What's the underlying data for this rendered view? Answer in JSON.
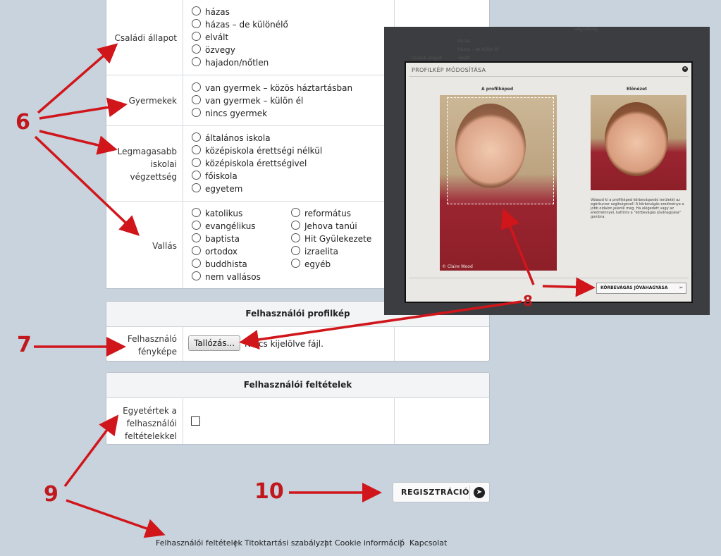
{
  "form": {
    "marital": {
      "label": "Családi állapot",
      "options": [
        "házas",
        "házas – de különélő",
        "elvált",
        "özvegy",
        "hajadon/nőtlen"
      ]
    },
    "children": {
      "label": "Gyermekek",
      "options": [
        "van gyermek – közös háztartásban",
        "van gyermek – külön él",
        "nincs gyermek"
      ]
    },
    "education": {
      "label_lines": [
        "Legmagasabb",
        "iskolai",
        "végzettség"
      ],
      "options": [
        "általános iskola",
        "középiskola érettségi nélkül",
        "középiskola érettségivel",
        "főiskola",
        "egyetem"
      ]
    },
    "religion": {
      "label": "Vallás",
      "options_left": [
        "katolikus",
        "evangélikus",
        "baptista",
        "ortodox",
        "buddhista",
        "nem vallásos"
      ],
      "options_right": [
        "református",
        "Jehova tanúi",
        "Hit Gyülekezete",
        "izraelita",
        "egyéb"
      ]
    }
  },
  "profile_panel": {
    "title": "Felhasználói profilkép",
    "label_lines": [
      "Felhasználó",
      "fényképe"
    ],
    "browse_label": "Tallózás...",
    "file_status": "Nincs kijelölve fájl."
  },
  "terms_panel": {
    "title": "Felhasználói feltételek",
    "label_lines": [
      "Egyetértek a",
      "felhasználói",
      "feltételekkel"
    ]
  },
  "register_button": {
    "label": "REGISZTRÁCIÓ"
  },
  "footer": {
    "links": [
      "Felhasználói feltételek",
      "Titoktartási szabályzat",
      "Cookie információ",
      "Kapcsolat"
    ],
    "separator": "|"
  },
  "annotations": [
    "6",
    "7",
    "8",
    "9",
    "10"
  ],
  "overlay": {
    "bg_options": [
      "házas",
      "házas – de külön él",
      "elvált"
    ],
    "bg_label": "Családi állapot",
    "bg_top_text": "végzettség",
    "modal_title": "PROFILKÉP MÓDOSÍTÁSA",
    "current_label": "A profilképed",
    "preview_label": "Előnézet",
    "help_text": "Válaszd ki a profilképed körbevágandó területét az egérkurzor segítségével! A körbevágás eredménye a jobb oldalon jelenik meg. Ha elégedett vagy az eredménnyel, kattints a \"körbevágás jóváhagyása\" gombra.",
    "credit": "© Claire Wood",
    "confirm_label": "KÖRBEVÁGÁS JÓVÁHAGYÁSA"
  },
  "colors": {
    "page_bg": "#c8d3dd",
    "annotation_red": "#c0181c",
    "overlay_bg": "#3b3d40"
  }
}
